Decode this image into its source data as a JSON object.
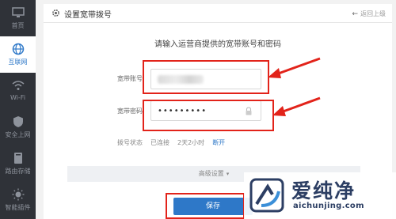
{
  "sidebar": {
    "items": [
      {
        "label": "首页",
        "icon": "monitor-icon"
      },
      {
        "label": "互联网",
        "icon": "globe-icon"
      },
      {
        "label": "Wi-Fi",
        "icon": "wifi-icon"
      },
      {
        "label": "安全上网",
        "icon": "shield-icon"
      },
      {
        "label": "路由存储",
        "icon": "storage-icon"
      },
      {
        "label": "智能插件",
        "icon": "sun-icon"
      }
    ]
  },
  "header": {
    "title": "设置宽带拨号",
    "back_label": "返回上级"
  },
  "form": {
    "prompt": "请输入运营商提供的宽带账号和密码",
    "account_label": "宽带账号",
    "password_label": "宽带密码",
    "password_value": "•••••••••",
    "status_label": "拨号状态",
    "status_value": "已连接",
    "duration": "2天2小时",
    "disconnect_label": "断开"
  },
  "advanced_label": "高级设置",
  "save_label": "保存",
  "watermark": {
    "brand": "爱纯净",
    "url": "aichunjing.com"
  },
  "colors": {
    "accent": "#2e78c8",
    "highlight": "#e2231a",
    "sidebar_bg": "#2f3238"
  }
}
